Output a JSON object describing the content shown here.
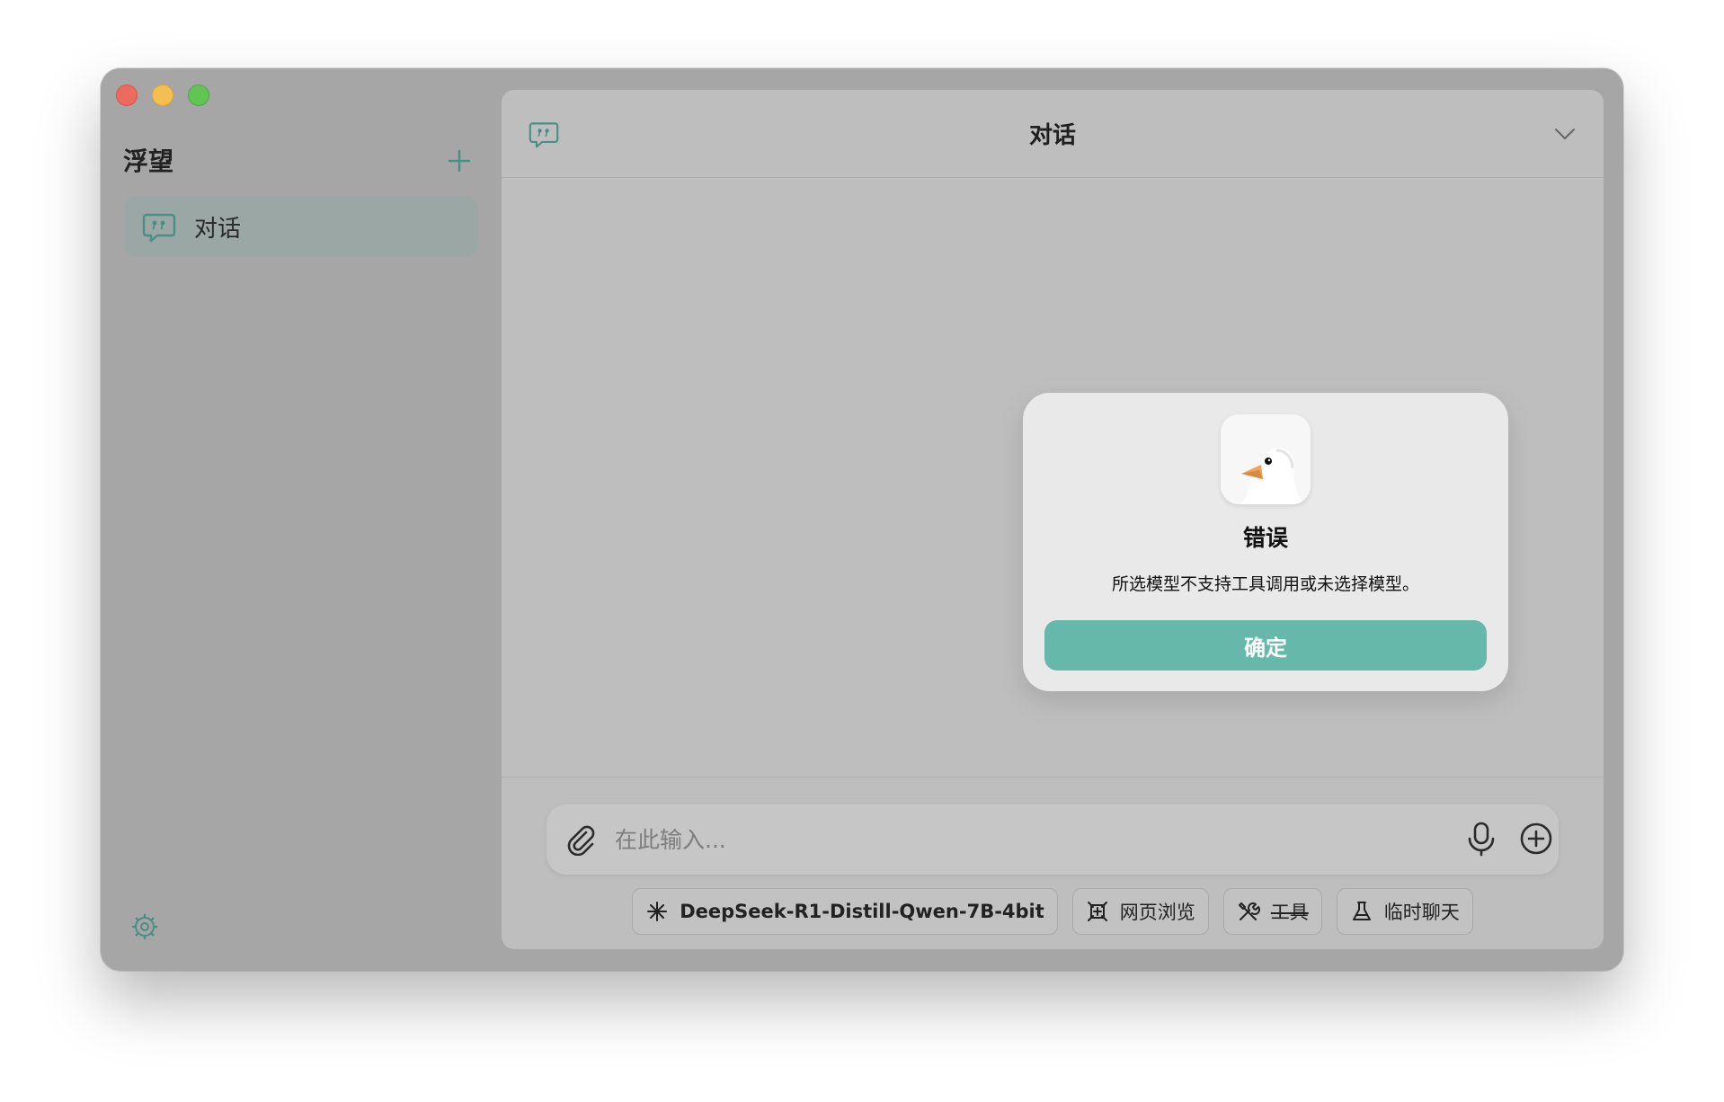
{
  "window": {
    "traffic_lights": [
      "close",
      "minimize",
      "zoom"
    ]
  },
  "sidebar": {
    "title": "浮望",
    "add_icon": "plus-icon",
    "items": [
      {
        "label": "对话",
        "icon": "chat-bubble-icon"
      }
    ],
    "settings_icon": "gear-icon"
  },
  "main": {
    "title": "对话",
    "header_icon": "chat-bubble-icon",
    "menu_icon": "chevron-down-icon"
  },
  "input": {
    "placeholder": "在此输入...",
    "value": ""
  },
  "chips": [
    {
      "label": "DeepSeek-R1-Distill-Qwen-7B-4bit",
      "icon": "sparkle-icon"
    },
    {
      "label": "网页浏览",
      "icon": "browse-icon"
    },
    {
      "label": "工具",
      "icon": "tools-icon",
      "struck": true
    },
    {
      "label": "临时聊天",
      "icon": "flask-icon"
    }
  ],
  "dialog": {
    "icon": "goose-app-icon",
    "title": "错误",
    "message": "所选模型不支持工具调用或未选择模型。",
    "ok_label": "确定"
  },
  "colors": {
    "accent": "#66b9aa",
    "sidebar_bg": "#a6a6a6",
    "main_bg": "#bebebe",
    "dialog_bg": "#e9e9e9"
  }
}
